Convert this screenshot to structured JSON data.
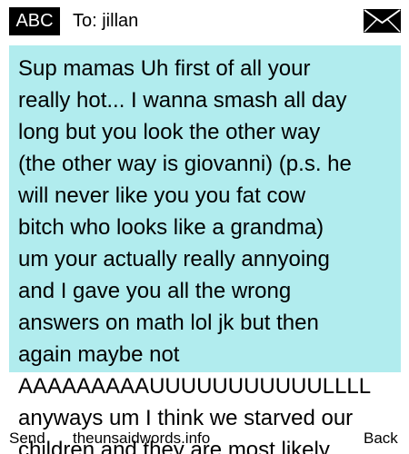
{
  "header": {
    "mode_badge": "ABC",
    "recipient": "To: jillan",
    "envelope_icon": "envelope-icon"
  },
  "message": {
    "lines": [
      "Sup mamas Uh first of all your",
      "really hot... I wanna smash all day",
      "long but you look the other way",
      "(the other way is giovanni) (p.s. he",
      "will never like you you fat cow",
      "bitch who looks like a grandma)",
      "um your actually really annyoing",
      "and I gave you all the wrong",
      "answers on math lol jk but then",
      "again maybe not",
      "AAAAAAAAAUUUUUUUUUUULLLL",
      "anyways um I think we starved our",
      "children and they are most likely"
    ]
  },
  "softkeys": {
    "left": "Send",
    "center": "theunsaidwords.info",
    "right": "Back"
  },
  "colors": {
    "message_background": "#b1ecee",
    "badge_background": "#000000",
    "badge_text": "#ffffff"
  }
}
